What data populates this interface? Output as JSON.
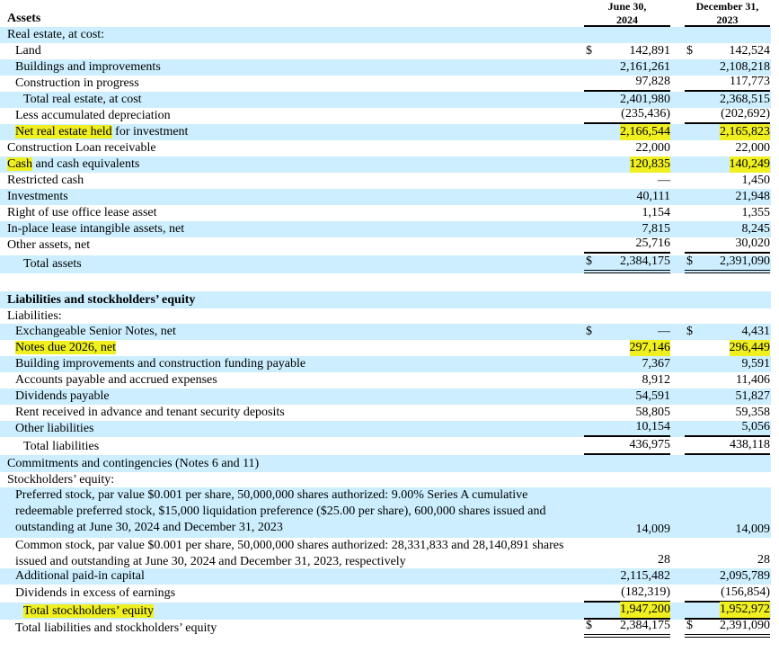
{
  "header": {
    "col1": [
      "June 30,",
      "2024"
    ],
    "col2": [
      "December 31,",
      "2023"
    ]
  },
  "rows": [
    {
      "label": "Assets",
      "c1": "",
      "c2": ""
    },
    {
      "label": "Real estate, at cost:",
      "c1": "",
      "c2": ""
    },
    {
      "label": "Land",
      "c1": "142,891",
      "c2": "142,524",
      "d1": "$",
      "d2": "$"
    },
    {
      "label": "Buildings and improvements",
      "c1": "2,161,261",
      "c2": "2,108,218"
    },
    {
      "label": "Construction in progress",
      "c1": "97,828",
      "c2": "117,773"
    },
    {
      "label": "Total real estate, at cost",
      "c1": "2,401,980",
      "c2": "2,368,515"
    },
    {
      "label": "Less accumulated depreciation",
      "c1": "(235,436)",
      "c2": "(202,692)"
    },
    {
      "label": "Net real estate held for investment",
      "c1": "2,166,544",
      "c2": "2,165,823"
    },
    {
      "label": "Construction Loan receivable",
      "c1": "22,000",
      "c2": "22,000"
    },
    {
      "label": "Cash and cash equivalents",
      "c1": "120,835",
      "c2": "140,249"
    },
    {
      "label": "Restricted cash",
      "c1": "—",
      "c2": "1,450"
    },
    {
      "label": "Investments",
      "c1": "40,111",
      "c2": "21,948"
    },
    {
      "label": "Right of use office lease asset",
      "c1": "1,154",
      "c2": "1,355"
    },
    {
      "label": "In-place lease intangible assets, net",
      "c1": "7,815",
      "c2": "8,245"
    },
    {
      "label": "Other assets, net",
      "c1": "25,716",
      "c2": "30,020"
    },
    {
      "label": "Total assets",
      "c1": "2,384,175",
      "c2": "2,391,090",
      "d1": "$",
      "d2": "$"
    },
    {
      "label": "",
      "c1": "",
      "c2": ""
    },
    {
      "label": "Liabilities and stockholders’ equity",
      "c1": "",
      "c2": ""
    },
    {
      "label": "Liabilities:",
      "c1": "",
      "c2": ""
    },
    {
      "label": "Exchangeable Senior Notes, net",
      "c1": "—",
      "c2": "4,431",
      "d1": "$",
      "d2": "$"
    },
    {
      "label": "Notes due 2026, net",
      "c1": "297,146",
      "c2": "296,449"
    },
    {
      "label": "Building improvements and construction funding payable",
      "c1": "7,367",
      "c2": "9,591"
    },
    {
      "label": "Accounts payable and accrued expenses",
      "c1": "8,912",
      "c2": "11,406"
    },
    {
      "label": "Dividends payable",
      "c1": "54,591",
      "c2": "51,827"
    },
    {
      "label": "Rent received in advance and tenant security deposits",
      "c1": "58,805",
      "c2": "59,358"
    },
    {
      "label": "Other liabilities",
      "c1": "10,154",
      "c2": "5,056"
    },
    {
      "label": "Total liabilities",
      "c1": "436,975",
      "c2": "438,118"
    },
    {
      "label": "Commitments and contingencies (Notes 6 and 11)",
      "c1": "",
      "c2": ""
    },
    {
      "label": "Stockholders’ equity:",
      "c1": "",
      "c2": ""
    },
    {
      "label": "Preferred stock, par value $0.001 per share, 50,000,000 shares authorized: 9.00% Series A cumulative redeemable preferred stock, $15,000 liquidation preference ($25.00 per share), 600,000 shares issued and outstanding at June 30, 2024 and December 31, 2023",
      "c1": "14,009",
      "c2": "14,009"
    },
    {
      "label": "Common stock, par value $0.001 per share, 50,000,000 shares authorized: 28,331,833 and 28,140,891 shares issued and outstanding at June 30, 2024 and December 31, 2023, respectively",
      "c1": "28",
      "c2": "28"
    },
    {
      "label": "Additional paid-in capital",
      "c1": "2,115,482",
      "c2": "2,095,789"
    },
    {
      "label": "Dividends in excess of earnings",
      "c1": "(182,319)",
      "c2": "(156,854)"
    },
    {
      "label": "Total stockholders’ equity",
      "c1": "1,947,200",
      "c2": "1,952,972"
    },
    {
      "label": "Total liabilities and stockholders’ equity",
      "c1": "2,384,175",
      "c2": "2,391,090",
      "d1": "$",
      "d2": "$"
    }
  ],
  "colors": {
    "band": "#cceeff",
    "highlight": "#f0f020"
  }
}
